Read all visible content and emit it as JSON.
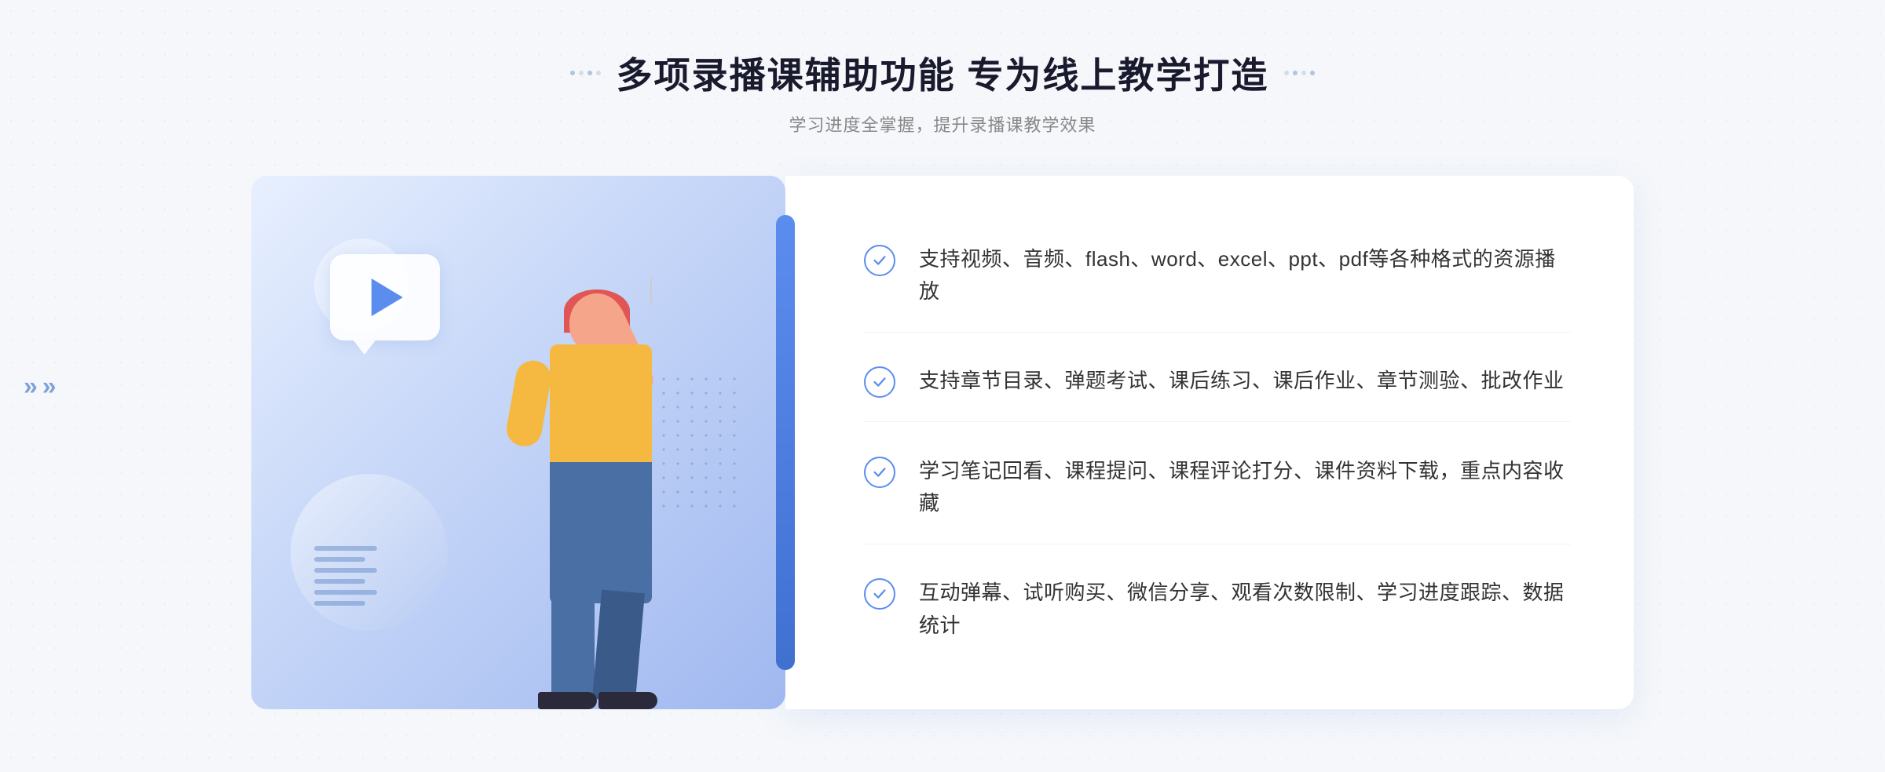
{
  "page": {
    "background_color": "#f5f7fa"
  },
  "header": {
    "title": "多项录播课辅助功能 专为线上教学打造",
    "subtitle": "学习进度全掌握，提升录播课教学效果",
    "decorator_dots": [
      "●",
      "●",
      "●"
    ]
  },
  "features": [
    {
      "id": 1,
      "text": "支持视频、音频、flash、word、excel、ppt、pdf等各种格式的资源播放"
    },
    {
      "id": 2,
      "text": "支持章节目录、弹题考试、课后练习、课后作业、章节测验、批改作业"
    },
    {
      "id": 3,
      "text": "学习笔记回看、课程提问、课程评论打分、课件资料下载，重点内容收藏"
    },
    {
      "id": 4,
      "text": "互动弹幕、试听购买、微信分享、观看次数限制、学习进度跟踪、数据统计"
    }
  ],
  "illustration": {
    "play_icon": "▶",
    "chevron_left": "«"
  }
}
